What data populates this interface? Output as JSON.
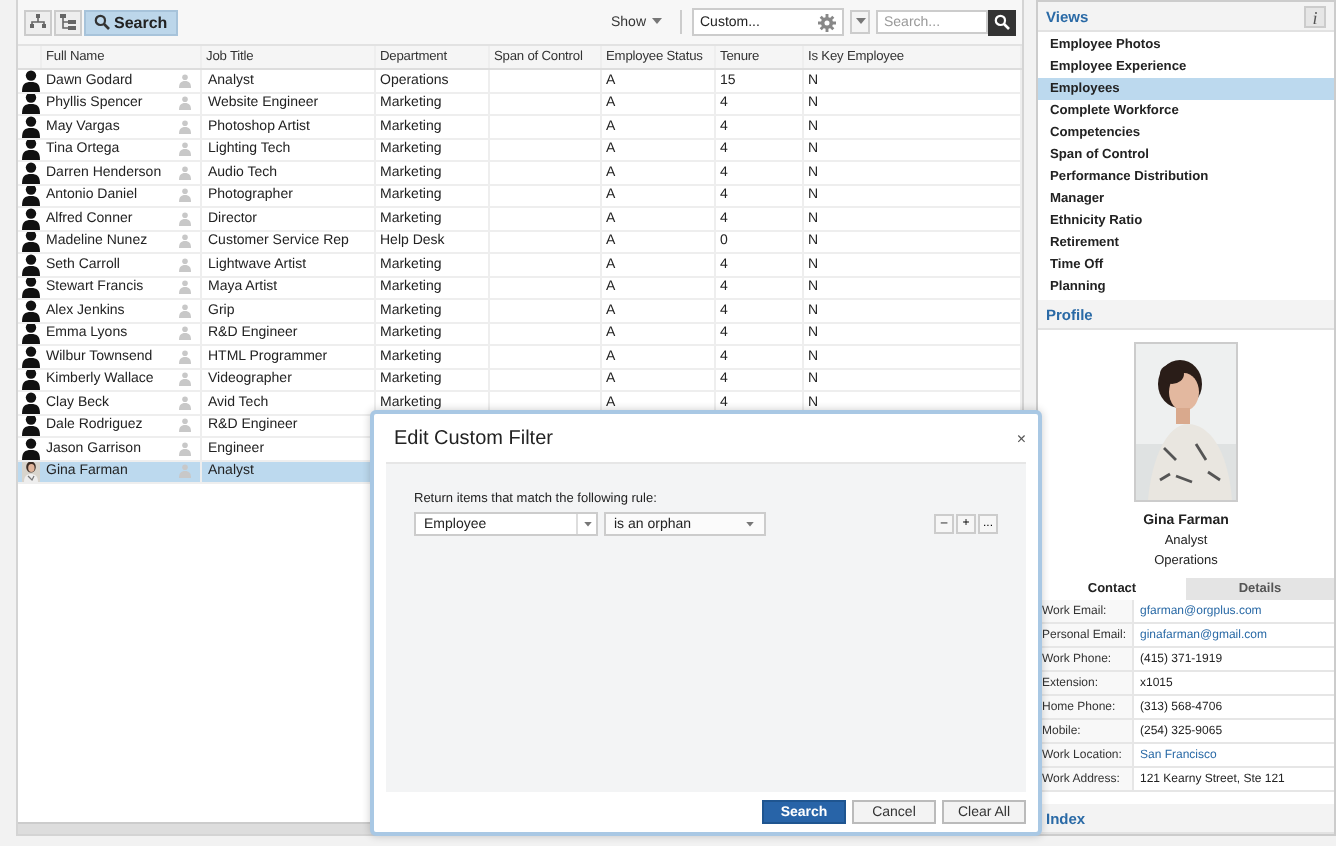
{
  "toolbar": {
    "buttons": [
      {
        "kind": "org",
        "selected": false
      },
      {
        "kind": "tree",
        "selected": false
      },
      {
        "kind": "search",
        "label": "Search",
        "selected": true
      }
    ],
    "show_menu": {
      "label": "Show"
    },
    "view_field": {
      "value": "Custom..."
    },
    "search": {
      "placeholder": "Search..."
    }
  },
  "table": {
    "columns": [
      "Full Name",
      "Job Title",
      "Department",
      "Span of Control",
      "Employee Status",
      "Tenure",
      "Is Key Employee"
    ],
    "rows": [
      {
        "kind": "silhouette",
        "name": "Dawn Godard",
        "job_title": "Analyst",
        "department": "Operations",
        "employee_status": "A",
        "tenure": "15",
        "is_key_employee": "N",
        "selected": false
      },
      {
        "kind": "silhouette",
        "name": "Phyllis Spencer",
        "job_title": "Website Engineer",
        "department": "Marketing",
        "employee_status": "A",
        "tenure": "4",
        "is_key_employee": "N",
        "selected": false
      },
      {
        "kind": "silhouette",
        "name": "May Vargas",
        "job_title": "Photoshop Artist",
        "department": "Marketing",
        "employee_status": "A",
        "tenure": "4",
        "is_key_employee": "N",
        "selected": false
      },
      {
        "kind": "silhouette",
        "name": "Tina Ortega",
        "job_title": "Lighting Tech",
        "department": "Marketing",
        "employee_status": "A",
        "tenure": "4",
        "is_key_employee": "N",
        "selected": false
      },
      {
        "kind": "silhouette",
        "name": "Darren Henderson",
        "job_title": "Audio Tech",
        "department": "Marketing",
        "employee_status": "A",
        "tenure": "4",
        "is_key_employee": "N",
        "selected": false
      },
      {
        "kind": "silhouette",
        "name": "Antonio Daniel",
        "job_title": "Photographer",
        "department": "Marketing",
        "employee_status": "A",
        "tenure": "4",
        "is_key_employee": "N",
        "selected": false
      },
      {
        "kind": "silhouette",
        "name": "Alfred Conner",
        "job_title": "Director",
        "department": "Marketing",
        "employee_status": "A",
        "tenure": "4",
        "is_key_employee": "N",
        "selected": false
      },
      {
        "kind": "silhouette",
        "name": "Madeline Nunez",
        "job_title": "Customer Service Rep",
        "department": "Help Desk",
        "employee_status": "A",
        "tenure": "0",
        "is_key_employee": "N",
        "selected": false
      },
      {
        "kind": "silhouette",
        "name": "Seth Carroll",
        "job_title": "Lightwave Artist",
        "department": "Marketing",
        "employee_status": "A",
        "tenure": "4",
        "is_key_employee": "N",
        "selected": false
      },
      {
        "kind": "silhouette",
        "name": "Stewart Francis",
        "job_title": "Maya Artist",
        "department": "Marketing",
        "employee_status": "A",
        "tenure": "4",
        "is_key_employee": "N",
        "selected": false
      },
      {
        "kind": "silhouette",
        "name": "Alex Jenkins",
        "job_title": "Grip",
        "department": "Marketing",
        "employee_status": "A",
        "tenure": "4",
        "is_key_employee": "N",
        "selected": false
      },
      {
        "kind": "silhouette",
        "name": "Emma Lyons",
        "job_title": "R&D Engineer",
        "department": "Marketing",
        "employee_status": "A",
        "tenure": "4",
        "is_key_employee": "N",
        "selected": false
      },
      {
        "kind": "silhouette",
        "name": "Wilbur Townsend",
        "job_title": "HTML Programmer",
        "department": "Marketing",
        "employee_status": "A",
        "tenure": "4",
        "is_key_employee": "N",
        "selected": false
      },
      {
        "kind": "silhouette",
        "name": "Kimberly Wallace",
        "job_title": "Videographer",
        "department": "Marketing",
        "employee_status": "A",
        "tenure": "4",
        "is_key_employee": "N",
        "selected": false
      },
      {
        "kind": "silhouette",
        "name": "Clay Beck",
        "job_title": "Avid Tech",
        "department": "Marketing",
        "employee_status": "A",
        "tenure": "4",
        "is_key_employee": "N",
        "selected": false
      },
      {
        "kind": "silhouette",
        "name": "Dale Rodriguez",
        "job_title": "R&D Engineer",
        "selected": false
      },
      {
        "kind": "silhouette",
        "name": "Jason Garrison",
        "job_title": "Engineer",
        "selected": false
      },
      {
        "name": "Gina Farman",
        "job_title": "Analyst",
        "selected": true
      }
    ]
  },
  "dialog": {
    "title": "Edit Custom Filter",
    "close": "×",
    "rule_label": "Return items that match the following rule:",
    "field": {
      "value": "Employee"
    },
    "operator": {
      "value": "is an orphan"
    },
    "rule_buttons": [
      "–",
      "+",
      "..."
    ],
    "buttons": [
      {
        "label": "Search",
        "kind": "primary"
      },
      {
        "label": "Cancel",
        "kind": "normal"
      },
      {
        "label": "Clear All",
        "kind": "normal"
      }
    ]
  },
  "views": {
    "title": "Views",
    "info": "i",
    "items": [
      {
        "label": "Employee Photos",
        "selected": false
      },
      {
        "label": "Employee Experience",
        "selected": false
      },
      {
        "label": "Employees",
        "selected": true
      },
      {
        "label": "Complete Workforce",
        "selected": false
      },
      {
        "label": "Competencies",
        "selected": false
      },
      {
        "label": "Span of Control",
        "selected": false
      },
      {
        "label": "Performance Distribution",
        "selected": false
      },
      {
        "label": "Manager",
        "selected": false
      },
      {
        "label": "Ethnicity Ratio",
        "selected": false
      },
      {
        "label": "Retirement",
        "selected": false
      },
      {
        "label": "Time Off",
        "selected": false
      },
      {
        "label": "Planning",
        "selected": false
      }
    ]
  },
  "profile": {
    "title": "Profile",
    "name": "Gina Farman",
    "job_title": "Analyst",
    "department": "Operations",
    "tabs": [
      {
        "label": "Contact",
        "selected": true
      },
      {
        "label": "Details",
        "selected": false
      }
    ],
    "fields": [
      {
        "label": "Work Email:",
        "value": "gfarman@orgplus.com",
        "kind": "link"
      },
      {
        "label": "Personal Email:",
        "value": "ginafarman@gmail.com",
        "kind": "link"
      },
      {
        "label": "Work Phone:",
        "value": "(415) 371-1919",
        "kind": "text"
      },
      {
        "label": "Extension:",
        "value": "x1015",
        "kind": "text"
      },
      {
        "label": "Home Phone:",
        "value": "(313) 568-4706",
        "kind": "text"
      },
      {
        "label": "Mobile:",
        "value": "(254) 325-9065",
        "kind": "text"
      },
      {
        "label": "Work Location:",
        "value": "San Francisco",
        "kind": "link"
      },
      {
        "label": "Work Address:",
        "value": "121 Kearny Street, Ste 121",
        "kind": "text"
      }
    ]
  },
  "index": {
    "title": "Index"
  }
}
